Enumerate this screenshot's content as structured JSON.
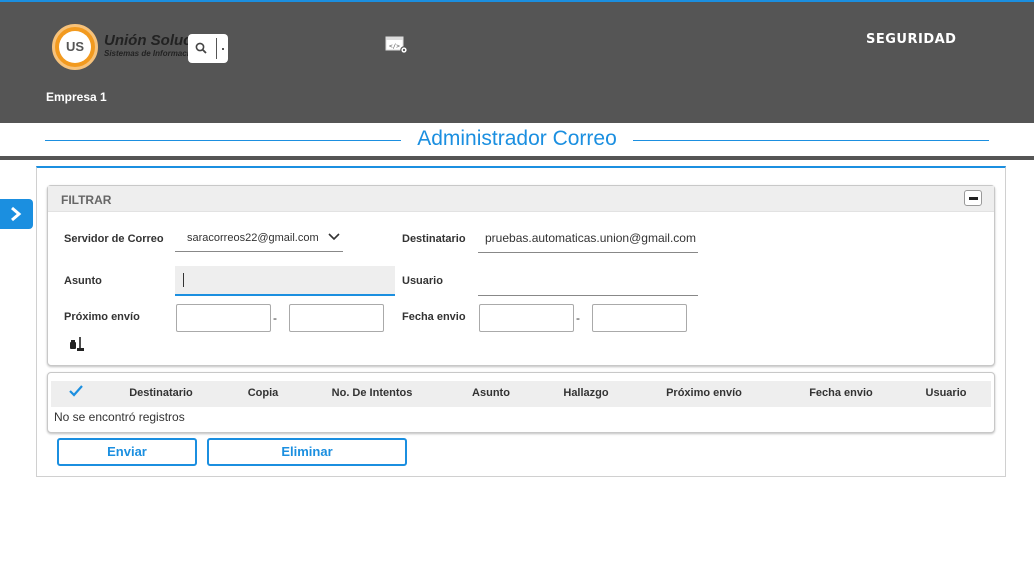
{
  "header": {
    "logo_text": "UNIÓN US",
    "brand_name": "Unión Soluciones",
    "brand_sub": "Sistemas de Información",
    "module": "SEGURIDAD",
    "empresa": "Empresa 1"
  },
  "page": {
    "title": "Administrador Correo"
  },
  "filter": {
    "title": "FILTRAR",
    "servidor_label": "Servidor de Correo",
    "servidor_value": "saracorreos22@gmail.com",
    "destinatario_label": "Destinatario",
    "destinatario_value": "pruebas.automaticas.union@gmail.com",
    "asunto_label": "Asunto",
    "asunto_value": "",
    "usuario_label": "Usuario",
    "usuario_value": "",
    "proximo_label": "Próximo envío",
    "fecha_label": "Fecha envio",
    "range_sep": "-"
  },
  "table": {
    "columns": [
      "Destinatario",
      "Copia",
      "No. De Intentos",
      "Asunto",
      "Hallazgo",
      "Próximo envío",
      "Fecha envio",
      "Usuario"
    ],
    "empty_message": "No se encontró registros"
  },
  "actions": {
    "enviar": "Enviar",
    "eliminar": "Eliminar"
  },
  "colors": {
    "accent": "#1b8fe0",
    "header_bg": "#555555",
    "logo_orange": "#f29a1f"
  }
}
